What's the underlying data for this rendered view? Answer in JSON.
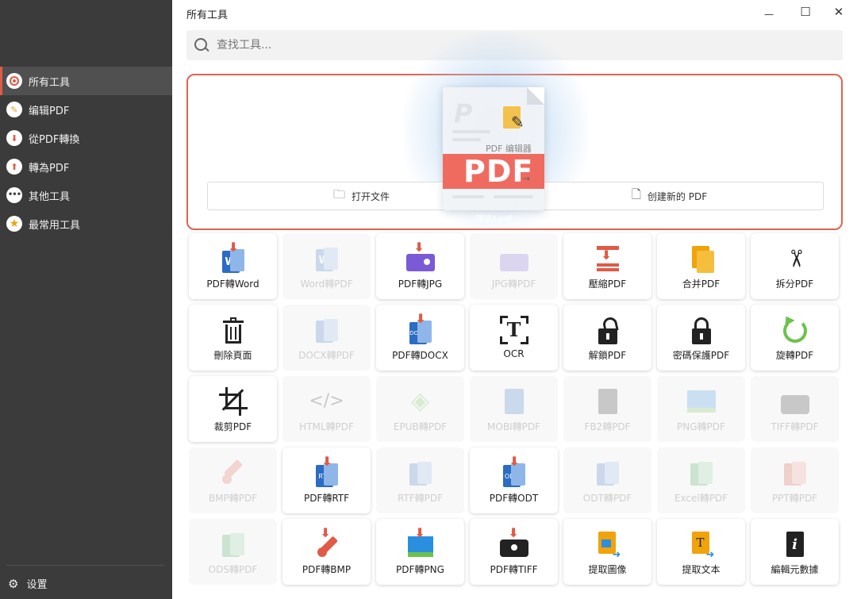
{
  "window": {
    "title": "所有工具",
    "minimize_glyph": "—",
    "maximize_glyph": "☐",
    "close_glyph": "✕"
  },
  "search": {
    "placeholder": "查找工具..."
  },
  "sidebar": {
    "items": [
      {
        "label": "所有工具",
        "icon": "all-tools-icon",
        "active": true
      },
      {
        "label": "编辑PDF",
        "icon": "edit-pdf-icon"
      },
      {
        "label": "從PDF轉換",
        "icon": "convert-from-pdf-icon"
      },
      {
        "label": "轉為PDF",
        "icon": "convert-to-pdf-icon"
      },
      {
        "label": "其他工具",
        "icon": "more-tools-icon"
      },
      {
        "label": "最常用工具",
        "icon": "star-icon"
      }
    ],
    "settings_label": "设置"
  },
  "dropzone": {
    "open_label": "打开文件",
    "create_label": "创建新的 PDF",
    "drag_file": {
      "editor_label": "PDF 编辑器",
      "band_text": "PDF",
      "file_name": "测试3.pdf"
    }
  },
  "tools": [
    {
      "label": "PDF轉Word",
      "icon": "pdf-to-word-icon",
      "enabled": true
    },
    {
      "label": "Word轉PDF",
      "icon": "word-to-pdf-icon",
      "enabled": false
    },
    {
      "label": "PDF轉JPG",
      "icon": "pdf-to-jpg-icon",
      "enabled": true
    },
    {
      "label": "JPG轉PDF",
      "icon": "jpg-to-pdf-icon",
      "enabled": false
    },
    {
      "label": "壓縮PDF",
      "icon": "compress-icon",
      "enabled": true
    },
    {
      "label": "合并PDF",
      "icon": "merge-icon",
      "enabled": true
    },
    {
      "label": "拆分PDF",
      "icon": "scissors-icon",
      "enabled": true
    },
    {
      "label": "刪除頁面",
      "icon": "trash-icon",
      "enabled": true
    },
    {
      "label": "DOCX轉PDF",
      "icon": "docx-to-pdf-icon",
      "enabled": false
    },
    {
      "label": "PDF轉DOCX",
      "icon": "pdf-to-docx-icon",
      "enabled": true
    },
    {
      "label": "OCR",
      "icon": "ocr-icon",
      "enabled": true
    },
    {
      "label": "解鎖PDF",
      "icon": "unlock-icon",
      "enabled": true
    },
    {
      "label": "密碼保護PDF",
      "icon": "lock-icon",
      "enabled": true
    },
    {
      "label": "旋轉PDF",
      "icon": "rotate-icon",
      "enabled": true
    },
    {
      "label": "裁剪PDF",
      "icon": "crop-icon",
      "enabled": true
    },
    {
      "label": "HTML轉PDF",
      "icon": "html-to-pdf-icon",
      "enabled": false
    },
    {
      "label": "EPUB轉PDF",
      "icon": "epub-to-pdf-icon",
      "enabled": false
    },
    {
      "label": "MOBI轉PDF",
      "icon": "mobi-to-pdf-icon",
      "enabled": false
    },
    {
      "label": "FB2轉PDF",
      "icon": "fb2-to-pdf-icon",
      "enabled": false
    },
    {
      "label": "PNG轉PDF",
      "icon": "png-to-pdf-icon",
      "enabled": false
    },
    {
      "label": "TIFF轉PDF",
      "icon": "tiff-to-pdf-icon",
      "enabled": false
    },
    {
      "label": "BMP轉PDF",
      "icon": "bmp-to-pdf-icon",
      "enabled": false
    },
    {
      "label": "PDF轉RTF",
      "icon": "pdf-to-rtf-icon",
      "enabled": true
    },
    {
      "label": "RTF轉PDF",
      "icon": "rtf-to-pdf-icon",
      "enabled": false
    },
    {
      "label": "PDF轉ODT",
      "icon": "pdf-to-odt-icon",
      "enabled": true
    },
    {
      "label": "ODT轉PDF",
      "icon": "odt-to-pdf-icon",
      "enabled": false
    },
    {
      "label": "Excel轉PDF",
      "icon": "excel-to-pdf-icon",
      "enabled": false
    },
    {
      "label": "PPT轉PDF",
      "icon": "ppt-to-pdf-icon",
      "enabled": false
    },
    {
      "label": "ODS轉PDF",
      "icon": "ods-to-pdf-icon",
      "enabled": false
    },
    {
      "label": "PDF轉BMP",
      "icon": "pdf-to-bmp-icon",
      "enabled": true
    },
    {
      "label": "PDF轉PNG",
      "icon": "pdf-to-png-icon",
      "enabled": true
    },
    {
      "label": "PDF轉TIFF",
      "icon": "pdf-to-tiff-icon",
      "enabled": true
    },
    {
      "label": "提取圖像",
      "icon": "extract-images-icon",
      "enabled": true
    },
    {
      "label": "提取文本",
      "icon": "extract-text-icon",
      "enabled": true
    },
    {
      "label": "編輯元數據",
      "icon": "metadata-icon",
      "enabled": true
    }
  ],
  "colors": {
    "accent": "#e0634f",
    "sidebar_bg": "#3b3b3b",
    "word_blue": "#2b6cc4",
    "arrow_red": "#e05a46"
  }
}
